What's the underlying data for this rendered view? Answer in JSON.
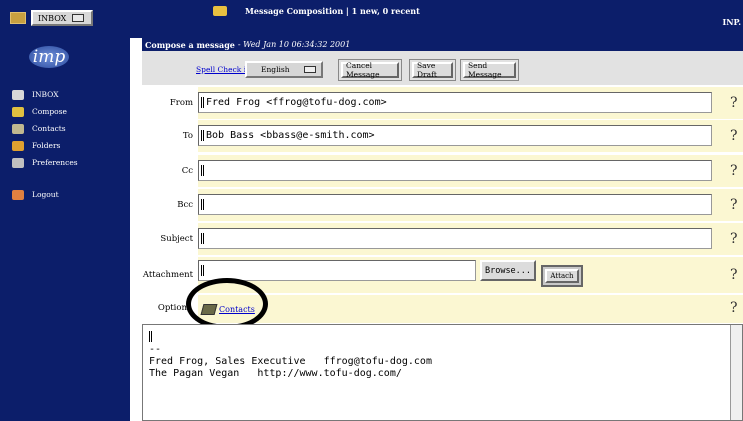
{
  "header": {
    "folder": "INBOX",
    "title": "Message Composition  |  1 new, 0 recent",
    "corner": "INP."
  },
  "sidebar": {
    "logo": "imp",
    "items": [
      {
        "label": "INBOX",
        "icon": "house-icon",
        "color": "#d8d8d8"
      },
      {
        "label": "Compose",
        "icon": "pencil-icon",
        "color": "#e0c040"
      },
      {
        "label": "Contacts",
        "icon": "book-icon",
        "color": "#c0b890"
      },
      {
        "label": "Folders",
        "icon": "folder-icon",
        "color": "#e0a030"
      },
      {
        "label": "Preferences",
        "icon": "tools-icon",
        "color": "#c0c0c0"
      }
    ],
    "logout": {
      "label": "Logout",
      "icon": "logout-icon",
      "color": "#e08040"
    }
  },
  "compose": {
    "heading": "Compose a message",
    "date": "- Wed Jan 10 06:34:32 2001",
    "spell_check": "Spell Check in",
    "language": "English",
    "buttons": [
      "Cancel Message",
      "Save Draft",
      "Send Message"
    ]
  },
  "fields": {
    "from": {
      "label": "From",
      "value": "Fred Frog <ffrog@tofu-dog.com>"
    },
    "to": {
      "label": "To",
      "value": "Bob Bass <bbass@e-smith.com>"
    },
    "cc": {
      "label": "Cc",
      "value": ""
    },
    "bcc": {
      "label": "Bcc",
      "value": ""
    },
    "subject": {
      "label": "Subject",
      "value": ""
    },
    "attachment": {
      "label": "Attachment",
      "value": "",
      "browse": "Browse...",
      "attach": "Attach"
    },
    "options": {
      "label": "Option",
      "contacts": "Contacts"
    }
  },
  "help_glyph": "?",
  "body": {
    "signature_line1": "--",
    "signature_line2": "Fred Frog, Sales Executive   ffrog@tofu-dog.com",
    "signature_line3": "The Pagan Vegan   http://www.tofu-dog.com/"
  }
}
